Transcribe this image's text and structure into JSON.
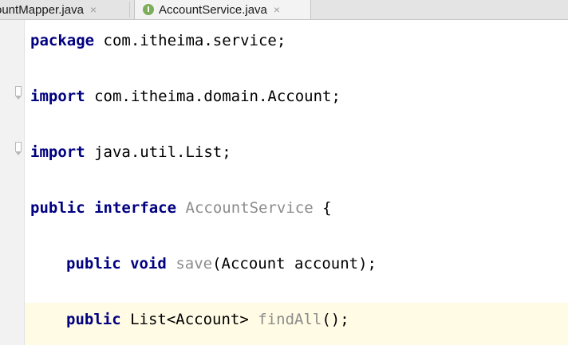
{
  "tabs": [
    {
      "label": "ountMapper.java",
      "close": "×",
      "active": false
    },
    {
      "label": "AccountService.java",
      "close": "×",
      "active": true,
      "icon": "I",
      "icon_name": "interface-icon",
      "icon_color": "#7cad5a"
    }
  ],
  "code": {
    "line1": {
      "kw": "package",
      "rest": " com.itheima.service;"
    },
    "line2": {
      "kw": "import",
      "rest": " com.itheima.domain.Account;"
    },
    "line3": {
      "kw": "import",
      "rest": " java.util.List;"
    },
    "line4": {
      "kw1": "public",
      "kw2": "interface",
      "name": "AccountService",
      "brace": " {"
    },
    "line5": {
      "kw1": "public",
      "kw2": "void",
      "method": "save",
      "params": "(Account account);"
    },
    "line6": {
      "kw1": "public",
      "type": "List<Account>",
      "method": "findAll",
      "tail": "();"
    }
  },
  "colors": {
    "keyword": "#000080",
    "unused_identifier": "#8c8c8c",
    "caret_row": "#fffbe5"
  }
}
